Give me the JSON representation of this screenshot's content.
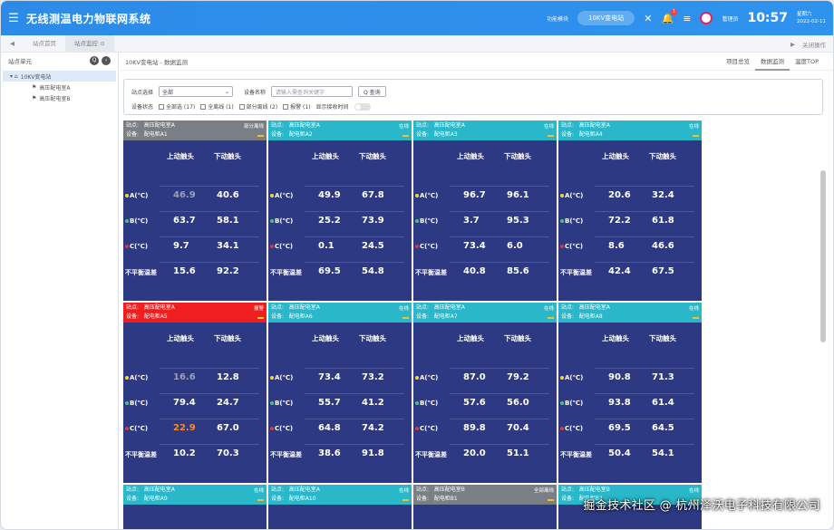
{
  "header": {
    "title": "无线测温电力物联网系统",
    "func_label": "功能模块",
    "station": "10KV变电站",
    "notify_count": "1",
    "user": "管理员",
    "time": "10:57",
    "weekday": "星期六",
    "date": "2022-02-11"
  },
  "tabs": {
    "items": [
      "站点首页",
      "站点监控 ⊙"
    ],
    "close_label": "关闭操作"
  },
  "sidebar": {
    "title": "站点单元",
    "root": "10KV变电站",
    "children": [
      "高压配电室A",
      "高压配电室B"
    ]
  },
  "main": {
    "breadcrumb": "10KV变电站 - 数据监测",
    "view_tabs": [
      "项目总览",
      "数据监测",
      "温度TOP"
    ],
    "filter": {
      "site_label": "站点选择",
      "site_value": "全部",
      "device_label": "设备名称",
      "device_placeholder": "请输入需查询关键字",
      "query_label": "Q 查询",
      "status_label": "设备状态",
      "options": [
        "全部选 (17)",
        "全离线 (1)",
        "部分离线 (2)",
        "报警 (1)"
      ],
      "show_time_label": "显示接收时间"
    }
  },
  "labels": {
    "site": "站点:",
    "device": "设备:",
    "col_upper": "上动触头",
    "col_lower": "下动触头",
    "rowA": "A(℃)",
    "rowB": "B(℃)",
    "rowC": "C(℃)",
    "rowD": "不平衡温差"
  },
  "colors": {
    "card_bg": "#2e3984",
    "head_online": "#2ab7c9",
    "head_partial": "#7a7f86",
    "head_alarm": "#f01e1e",
    "dot_a": "#f7d23a",
    "dot_b": "#49c46a",
    "dot_c": "#e8322d"
  },
  "cards": [
    {
      "site": "高压配电室A",
      "device": "配电柜A1",
      "status": "部分离线",
      "head": "partial",
      "a": [
        "46.9",
        "40.6"
      ],
      "b": [
        "63.7",
        "58.1"
      ],
      "c": [
        "9.7",
        "34.1"
      ],
      "d": [
        "15.6",
        "92.2"
      ],
      "aGrey": true
    },
    {
      "site": "高压配电室A",
      "device": "配电柜A2",
      "status": "在线",
      "head": "online",
      "a": [
        "49.9",
        "67.8"
      ],
      "b": [
        "25.2",
        "73.9"
      ],
      "c": [
        "0.1",
        "24.5"
      ],
      "d": [
        "69.5",
        "54.8"
      ]
    },
    {
      "site": "高压配电室A",
      "device": "配电柜A3",
      "status": "在线",
      "head": "online",
      "a": [
        "96.7",
        "96.1"
      ],
      "b": [
        "3.7",
        "95.3"
      ],
      "c": [
        "73.4",
        "6.0"
      ],
      "d": [
        "40.8",
        "85.6"
      ]
    },
    {
      "site": "高压配电室A",
      "device": "配电柜A4",
      "status": "在线",
      "head": "online",
      "a": [
        "20.6",
        "32.4"
      ],
      "b": [
        "72.2",
        "61.8"
      ],
      "c": [
        "8.6",
        "46.6"
      ],
      "d": [
        "42.4",
        "67.5"
      ]
    },
    {
      "site": "高压配电室A",
      "device": "配电柜A5",
      "status": "报警",
      "head": "alarm",
      "a": [
        "16.6",
        "12.8"
      ],
      "b": [
        "79.4",
        "24.7"
      ],
      "c": [
        "22.9",
        "67.0"
      ],
      "d": [
        "10.2",
        "70.3"
      ],
      "aGrey": true,
      "cOrange": true
    },
    {
      "site": "高压配电室A",
      "device": "配电柜A6",
      "status": "在线",
      "head": "online",
      "a": [
        "73.4",
        "73.2"
      ],
      "b": [
        "55.7",
        "41.2"
      ],
      "c": [
        "64.8",
        "74.2"
      ],
      "d": [
        "38.6",
        "91.8"
      ]
    },
    {
      "site": "高压配电室A",
      "device": "配电柜A7",
      "status": "在线",
      "head": "online",
      "a": [
        "87.0",
        "79.2"
      ],
      "b": [
        "57.6",
        "56.0"
      ],
      "c": [
        "89.8",
        "70.4"
      ],
      "d": [
        "20.0",
        "51.1"
      ]
    },
    {
      "site": "高压配电室A",
      "device": "配电柜A8",
      "status": "在线",
      "head": "online",
      "a": [
        "90.8",
        "71.3"
      ],
      "b": [
        "93.8",
        "61.4"
      ],
      "c": [
        "69.5",
        "64.5"
      ],
      "d": [
        "50.4",
        "54.1"
      ]
    },
    {
      "site": "高压配电室A",
      "device": "配电柜A9",
      "status": "在线",
      "head": "online"
    },
    {
      "site": "高压配电室A",
      "device": "配电柜A10",
      "status": "在线",
      "head": "online"
    },
    {
      "site": "高压配电室B",
      "device": "配电柜B1",
      "status": "全部离线",
      "head": "partial"
    },
    {
      "site": "高压配电室B",
      "device": "配电柜B2",
      "status": "在线",
      "head": "online"
    }
  ],
  "watermark": "掘金技术社区 @ 杭州泽沃电子科技有限公司"
}
